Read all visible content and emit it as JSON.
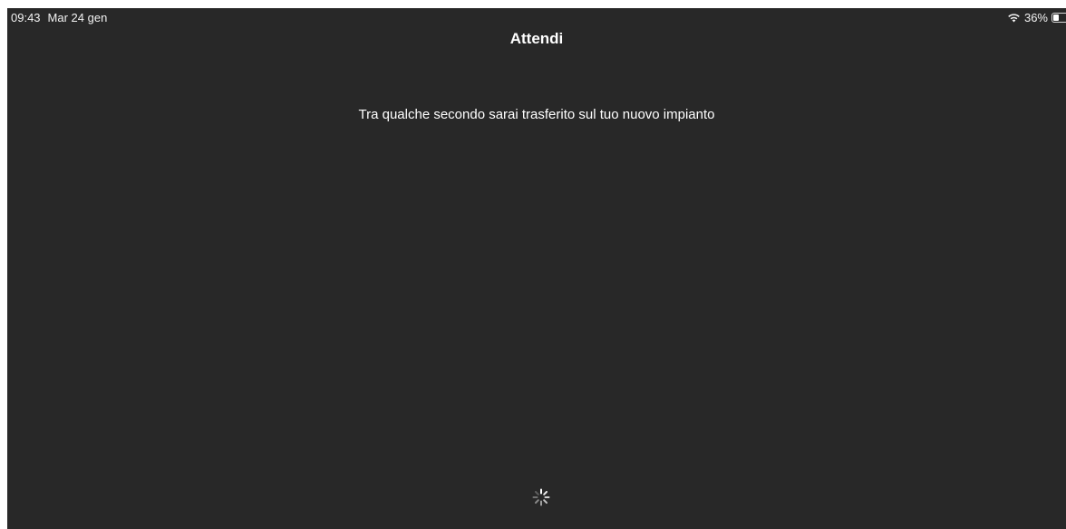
{
  "status_bar": {
    "time": "09:43",
    "date": "Mar 24 gen",
    "battery_percent": "36%",
    "battery_level": 0.36,
    "wifi_icon": "wifi-icon",
    "battery_icon": "battery-icon"
  },
  "nav": {
    "title": "Attendi"
  },
  "main": {
    "message": "Tra qualche secondo sarai trasferito sul tuo nuovo impianto",
    "spinner_icon": "activity-spinner-icon"
  },
  "colors": {
    "background": "#282828",
    "text": "#ffffff"
  }
}
